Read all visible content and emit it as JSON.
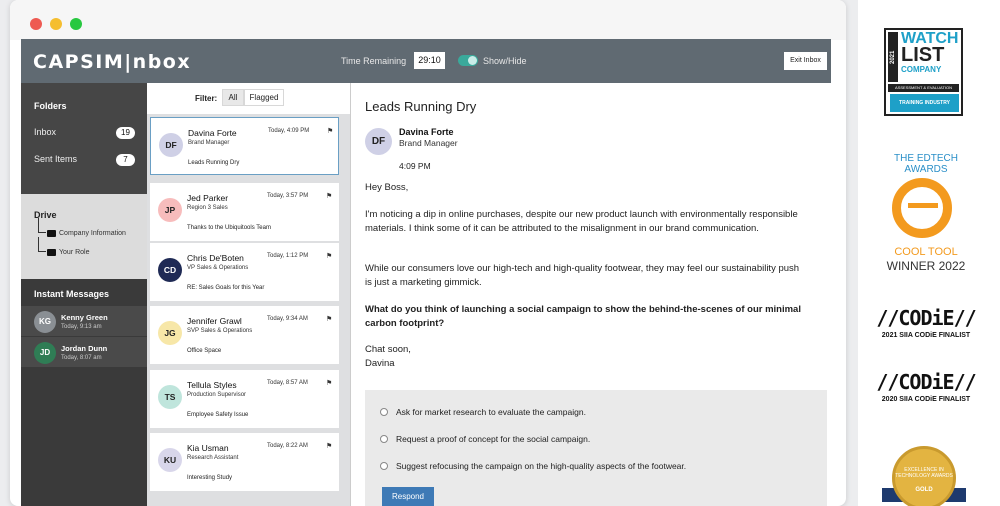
{
  "app": {
    "logo": "CAPSIM|nbox",
    "time_remaining_label": "Time Remaining",
    "time_remaining_value": "29:10",
    "show_hide_label": "Show/Hide",
    "exit_label": "Exit Inbox"
  },
  "sidebar": {
    "folders_heading": "Folders",
    "folders": [
      {
        "label": "Inbox",
        "count": "19"
      },
      {
        "label": "Sent Items",
        "count": "7"
      }
    ],
    "drive_heading": "Drive",
    "drive_items": [
      "Company Information",
      "Your Role"
    ],
    "im_heading": "Instant Messages",
    "instant_messages": [
      {
        "initials": "KG",
        "name": "Kenny Green",
        "time": "Today, 9:13 am",
        "color": "#8a8f94"
      },
      {
        "initials": "JD",
        "name": "Jordan Dunn",
        "time": "Today, 8:07 am",
        "color": "#2f7d55"
      }
    ]
  },
  "filter": {
    "label": "Filter:",
    "all": "All",
    "flagged": "Flagged"
  },
  "messages": [
    {
      "initials": "DF",
      "name": "Davina Forte",
      "role": "Brand Manager",
      "time": "Today, 4:09 PM",
      "subject": "Leads Running Dry",
      "avatar_bg": "#cfd0e6",
      "avatar_fg": "#222222"
    },
    {
      "initials": "JP",
      "name": "Jed Parker",
      "role": "Region 3 Sales",
      "time": "Today, 3:57 PM",
      "subject": "Thanks to the Ubiquitools Team",
      "avatar_bg": "#f7bcbc",
      "avatar_fg": "#222222"
    },
    {
      "initials": "CD",
      "name": "Chris De'Boten",
      "role": "VP Sales & Operations",
      "time": "Today, 1:12 PM",
      "subject": "RE: Sales Goals for this Year",
      "avatar_bg": "#1f2a55",
      "avatar_fg": "#ffffff"
    },
    {
      "initials": "JG",
      "name": "Jennifer Grawl",
      "role": "SVP Sales & Operations",
      "time": "Today, 9:34 AM",
      "subject": "Office Space",
      "avatar_bg": "#f7e7a8",
      "avatar_fg": "#222222"
    },
    {
      "initials": "TS",
      "name": "Tellula Styles",
      "role": "Production Supervisor",
      "time": "Today, 8:57 AM",
      "subject": "Employee Safety Issue",
      "avatar_bg": "#bfe5dc",
      "avatar_fg": "#222222"
    },
    {
      "initials": "KU",
      "name": "Kia Usman",
      "role": "Research Assistant",
      "time": "Today, 8:22 AM",
      "subject": "Interesting Study",
      "avatar_bg": "#d8d6ea",
      "avatar_fg": "#222222"
    }
  ],
  "email": {
    "subject": "Leads Running Dry",
    "sender_initials": "DF",
    "sender_name": "Davina Forte",
    "sender_role": "Brand Manager",
    "time": "4:09 PM",
    "greeting": "Hey Boss,",
    "p1": "I'm noticing a dip in online purchases, despite our new product launch with environmentally responsible materials. I think some of it can be attributed to the misalignment in our brand communication.",
    "p2": "While our consumers love our high-tech and high-quality footwear, they may feel our sustainability push is just a marketing gimmick.",
    "p3": "What do you think of launching a social campaign to show the behind-the-scenes of our minimal carbon footprint?",
    "signoff": "Chat soon,",
    "signature": "Davina"
  },
  "options": [
    "Ask for market research to evaluate the campaign.",
    "Request a proof of concept for the social campaign.",
    "Suggest refocusing the campaign on the high-quality aspects of the footwear."
  ],
  "respond_label": "Respond",
  "awards": {
    "watchlist_year": "2021",
    "watchlist_watch": "WATCH",
    "watchlist_list": "LIST",
    "watchlist_company": "COMPANY",
    "watchlist_category": "ASSESSMENT & EVALUATION",
    "watchlist_org": "TRAINING INDUSTRY",
    "edtech_title": "THE EDTECH AWARDS",
    "edtech_cool": "COOL TOOL",
    "edtech_winner": "WINNER 2022",
    "codie_logo": "//CODiE//",
    "codie_2021": "2021 SIIA CODiE FINALIST",
    "codie_2020": "2020 SIIA CODiE FINALIST",
    "bh_text": "EXCELLENCE IN TECHNOLOGY AWARDS",
    "bh_gold": "GOLD"
  }
}
